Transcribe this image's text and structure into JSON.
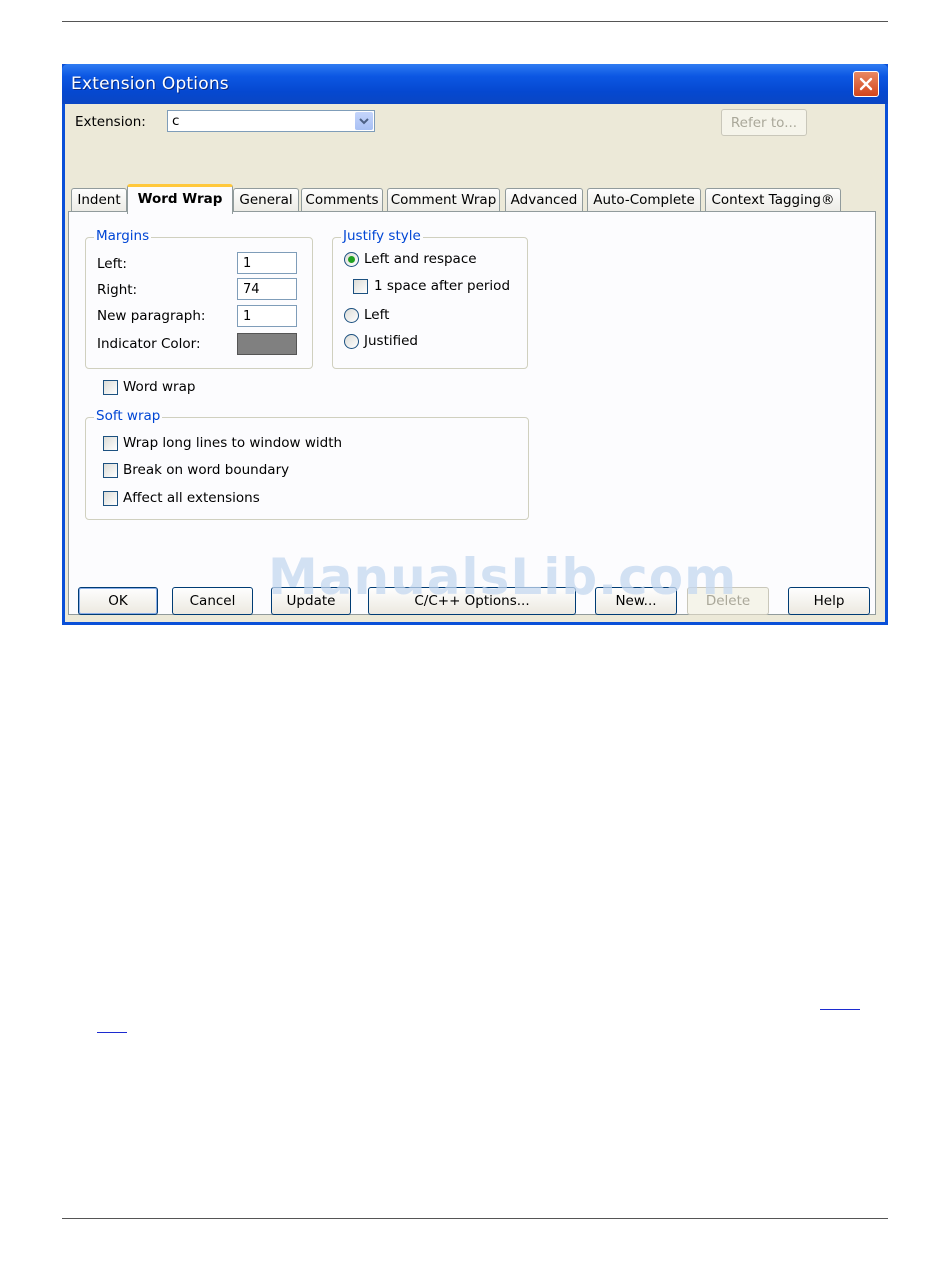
{
  "dialog": {
    "title": "Extension Options",
    "extension_label": "Extension:",
    "extension_value": "c",
    "refer_to_label": "Refer to..."
  },
  "tabs": [
    {
      "label": "Indent"
    },
    {
      "label": "Word Wrap"
    },
    {
      "label": "General"
    },
    {
      "label": "Comments"
    },
    {
      "label": "Comment Wrap"
    },
    {
      "label": "Advanced"
    },
    {
      "label": "Auto-Complete"
    },
    {
      "label": "Context Tagging®"
    }
  ],
  "active_tab": "Word Wrap",
  "margins": {
    "group_label": "Margins",
    "left_label": "Left:",
    "left_value": "1",
    "right_label": "Right:",
    "right_value": "74",
    "new_paragraph_label": "New paragraph:",
    "new_paragraph_value": "1",
    "indicator_color_label": "Indicator Color:",
    "indicator_color": "#808080"
  },
  "justify": {
    "group_label": "Justify style",
    "left_and_respace_label": "Left and respace",
    "left_and_respace_selected": true,
    "one_space_label": "1 space after period",
    "one_space_checked": false,
    "left_label": "Left",
    "left_selected": false,
    "justified_label": "Justified",
    "justified_selected": false
  },
  "word_wrap": {
    "label": "Word wrap",
    "checked": false
  },
  "soft_wrap": {
    "group_label": "Soft wrap",
    "wrap_long_lines_label": "Wrap long lines to window width",
    "break_on_word_label": "Break on word boundary",
    "affect_all_label": "Affect all extensions"
  },
  "buttons": {
    "ok": "OK",
    "cancel": "Cancel",
    "update": "Update",
    "cpp_options": "C/C++ Options...",
    "new": "New...",
    "delete": "Delete",
    "help": "Help"
  },
  "watermark": "ManualsLib.com",
  "colors": {
    "titlebar": "#0a50d8",
    "dialog_face": "#ece9d8",
    "group_label": "#0046d5",
    "active_tab_accent": "#ffc83c"
  }
}
